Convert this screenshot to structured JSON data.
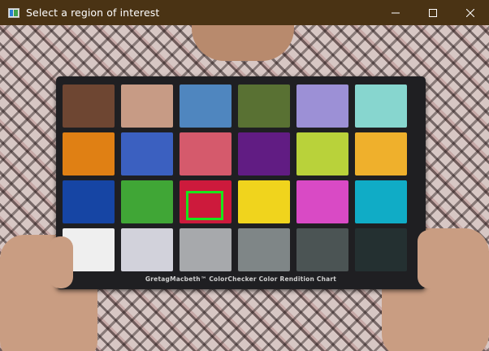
{
  "window": {
    "title": "Select a region of interest"
  },
  "controls": {
    "minimize": "minimize-icon",
    "maximize": "maximize-icon",
    "close": "close-icon"
  },
  "chart": {
    "caption": "GretagMacbeth™ ColorChecker Color Rendition Chart",
    "patches": [
      {
        "color": "#6e4632"
      },
      {
        "color": "#c79b85"
      },
      {
        "color": "#4f86bf"
      },
      {
        "color": "#597133"
      },
      {
        "color": "#9c90d6"
      },
      {
        "color": "#87d6cf"
      },
      {
        "color": "#e08014"
      },
      {
        "color": "#3b60c0"
      },
      {
        "color": "#d55a6c"
      },
      {
        "color": "#611c83"
      },
      {
        "color": "#b9d23a"
      },
      {
        "color": "#efb02c"
      },
      {
        "color": "#1645a4"
      },
      {
        "color": "#40a636"
      },
      {
        "color": "#cd1a3c"
      },
      {
        "color": "#f0d41d"
      },
      {
        "color": "#d94ac5"
      },
      {
        "color": "#10acc6"
      },
      {
        "color": "#efefef"
      },
      {
        "color": "#d2d2db"
      },
      {
        "color": "#a7a9ac"
      },
      {
        "color": "#7f8687"
      },
      {
        "color": "#4b5454"
      },
      {
        "color": "#243031"
      }
    ]
  },
  "selection": {
    "color": "#19e61b"
  }
}
